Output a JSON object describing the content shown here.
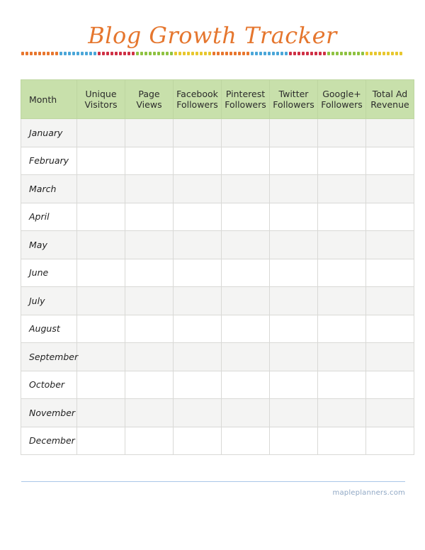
{
  "document": {
    "title": "Blog Growth Tracker"
  },
  "decor": {
    "dot_colors": [
      "#e8762e",
      "#4aa6d8",
      "#cf3045",
      "#8fc241",
      "#e8c72e"
    ],
    "dot_count": 90,
    "dot_group_size": 9
  },
  "table": {
    "headers": [
      {
        "label": "Month",
        "align": "left"
      },
      {
        "label": "Unique Visitors",
        "align": "center"
      },
      {
        "label": "Page Views",
        "align": "center"
      },
      {
        "label": "Facebook Followers",
        "align": "center"
      },
      {
        "label": "Pinterest Followers",
        "align": "center"
      },
      {
        "label": "Twitter Followers",
        "align": "center"
      },
      {
        "label": "Google+ Followers",
        "align": "center"
      },
      {
        "label": "Total Ad Revenue",
        "align": "center"
      }
    ],
    "header_bg": "#c8e0ab",
    "row_alt_bg": "#f4f4f3",
    "border_color": "#d9d9d6",
    "rows": [
      {
        "month": "January",
        "unique_visitors": "",
        "page_views": "",
        "facebook_followers": "",
        "pinterest_followers": "",
        "twitter_followers": "",
        "googleplus_followers": "",
        "total_ad_revenue": ""
      },
      {
        "month": "February",
        "unique_visitors": "",
        "page_views": "",
        "facebook_followers": "",
        "pinterest_followers": "",
        "twitter_followers": "",
        "googleplus_followers": "",
        "total_ad_revenue": ""
      },
      {
        "month": "March",
        "unique_visitors": "",
        "page_views": "",
        "facebook_followers": "",
        "pinterest_followers": "",
        "twitter_followers": "",
        "googleplus_followers": "",
        "total_ad_revenue": ""
      },
      {
        "month": "April",
        "unique_visitors": "",
        "page_views": "",
        "facebook_followers": "",
        "pinterest_followers": "",
        "twitter_followers": "",
        "googleplus_followers": "",
        "total_ad_revenue": ""
      },
      {
        "month": "May",
        "unique_visitors": "",
        "page_views": "",
        "facebook_followers": "",
        "pinterest_followers": "",
        "twitter_followers": "",
        "googleplus_followers": "",
        "total_ad_revenue": ""
      },
      {
        "month": "June",
        "unique_visitors": "",
        "page_views": "",
        "facebook_followers": "",
        "pinterest_followers": "",
        "twitter_followers": "",
        "googleplus_followers": "",
        "total_ad_revenue": ""
      },
      {
        "month": "July",
        "unique_visitors": "",
        "page_views": "",
        "facebook_followers": "",
        "pinterest_followers": "",
        "twitter_followers": "",
        "googleplus_followers": "",
        "total_ad_revenue": ""
      },
      {
        "month": "August",
        "unique_visitors": "",
        "page_views": "",
        "facebook_followers": "",
        "pinterest_followers": "",
        "twitter_followers": "",
        "googleplus_followers": "",
        "total_ad_revenue": ""
      },
      {
        "month": "September",
        "unique_visitors": "",
        "page_views": "",
        "facebook_followers": "",
        "pinterest_followers": "",
        "twitter_followers": "",
        "googleplus_followers": "",
        "total_ad_revenue": ""
      },
      {
        "month": "October",
        "unique_visitors": "",
        "page_views": "",
        "facebook_followers": "",
        "pinterest_followers": "",
        "twitter_followers": "",
        "googleplus_followers": "",
        "total_ad_revenue": ""
      },
      {
        "month": "November",
        "unique_visitors": "",
        "page_views": "",
        "facebook_followers": "",
        "pinterest_followers": "",
        "twitter_followers": "",
        "googleplus_followers": "",
        "total_ad_revenue": ""
      },
      {
        "month": "December",
        "unique_visitors": "",
        "page_views": "",
        "facebook_followers": "",
        "pinterest_followers": "",
        "twitter_followers": "",
        "googleplus_followers": "",
        "total_ad_revenue": ""
      }
    ]
  },
  "footer": {
    "site": "mapleplanners.com",
    "rule_color": "#a9c6e8"
  },
  "colors": {
    "title": "#e5762e",
    "header_green": "#c8e0ab",
    "footer_blue": "#8fa7c4"
  }
}
